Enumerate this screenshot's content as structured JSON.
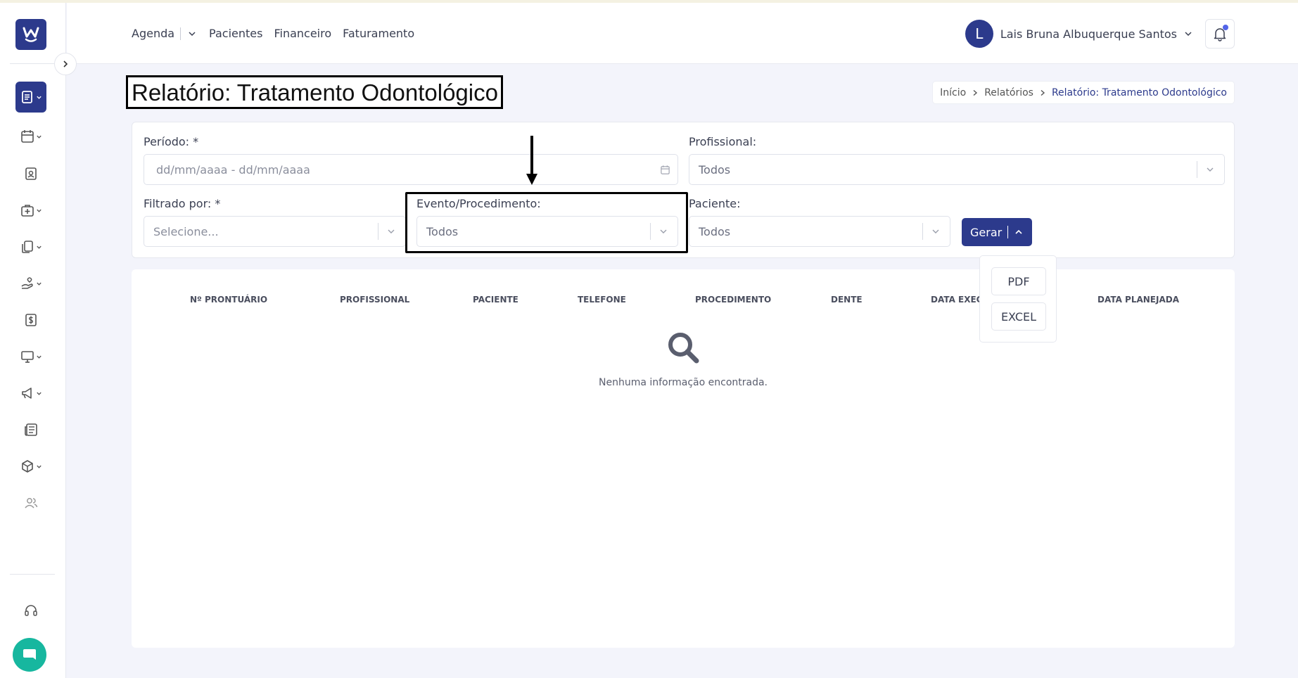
{
  "nav": {
    "links": [
      "Agenda",
      "Pacientes",
      "Financeiro",
      "Faturamento"
    ]
  },
  "user": {
    "initial": "L",
    "name": "Lais Bruna Albuquerque Santos"
  },
  "page": {
    "title": "Relatório: Tratamento Odontológico"
  },
  "breadcrumb": {
    "items": [
      "Início",
      "Relatórios",
      "Relatório: Tratamento Odontológico"
    ]
  },
  "filters": {
    "periodo": {
      "label": "Período: *",
      "placeholder": "dd/mm/aaaa - dd/mm/aaaa"
    },
    "profissional": {
      "label": "Profissional:",
      "value": "Todos"
    },
    "filtrado": {
      "label": "Filtrado por: *",
      "placeholder": "Selecione..."
    },
    "evento": {
      "label": "Evento/Procedimento:",
      "value": "Todos"
    },
    "paciente": {
      "label": "Paciente:",
      "value": "Todos"
    },
    "gerar_label": "Gerar"
  },
  "export_menu": {
    "pdf": "PDF",
    "excel": "EXCEL"
  },
  "table": {
    "columns": [
      "Nº PRONTUÁRIO",
      "PROFISSIONAL",
      "PACIENTE",
      "TELEFONE",
      "PROCEDIMENTO",
      "DENTE",
      "DATA EXECU",
      "DATA PLANEJADA"
    ],
    "empty_message": "Nenhuma informação encontrada."
  },
  "colors": {
    "brand": "#2c3a8c",
    "chat": "#17b79f",
    "notification_dot": "#5264e8"
  }
}
